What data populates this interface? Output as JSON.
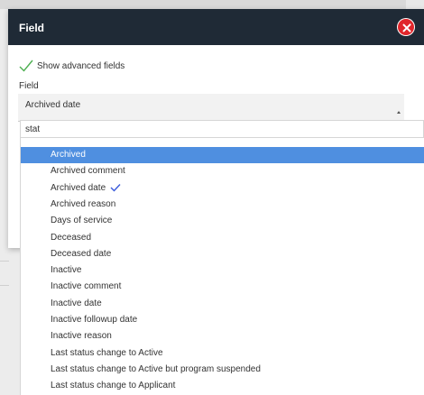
{
  "modal": {
    "title": "Field",
    "close_icon": "close-x-icon",
    "close_color": "#e0262b",
    "header_color": "#1f2a36"
  },
  "advanced": {
    "label": "Show advanced fields",
    "checked": true,
    "icon": "checkmark-icon"
  },
  "field": {
    "label": "Field",
    "selected_value": "Archived date"
  },
  "search": {
    "value": "stat"
  },
  "dropdown": {
    "highlight_color": "#4f8fe0",
    "options": [
      {
        "label": "Archived",
        "highlighted": true,
        "selected": false
      },
      {
        "label": "Archived comment",
        "highlighted": false,
        "selected": false
      },
      {
        "label": "Archived date",
        "highlighted": false,
        "selected": true
      },
      {
        "label": "Archived reason",
        "highlighted": false,
        "selected": false
      },
      {
        "label": "Days of service",
        "highlighted": false,
        "selected": false
      },
      {
        "label": "Deceased",
        "highlighted": false,
        "selected": false
      },
      {
        "label": "Deceased date",
        "highlighted": false,
        "selected": false
      },
      {
        "label": "Inactive",
        "highlighted": false,
        "selected": false
      },
      {
        "label": "Inactive comment",
        "highlighted": false,
        "selected": false
      },
      {
        "label": "Inactive date",
        "highlighted": false,
        "selected": false
      },
      {
        "label": "Inactive followup date",
        "highlighted": false,
        "selected": false
      },
      {
        "label": "Inactive reason",
        "highlighted": false,
        "selected": false
      },
      {
        "label": "Last status change to Active",
        "highlighted": false,
        "selected": false
      },
      {
        "label": "Last status change to Active but program suspended",
        "highlighted": false,
        "selected": false
      },
      {
        "label": "Last status change to Applicant",
        "highlighted": false,
        "selected": false
      }
    ]
  }
}
